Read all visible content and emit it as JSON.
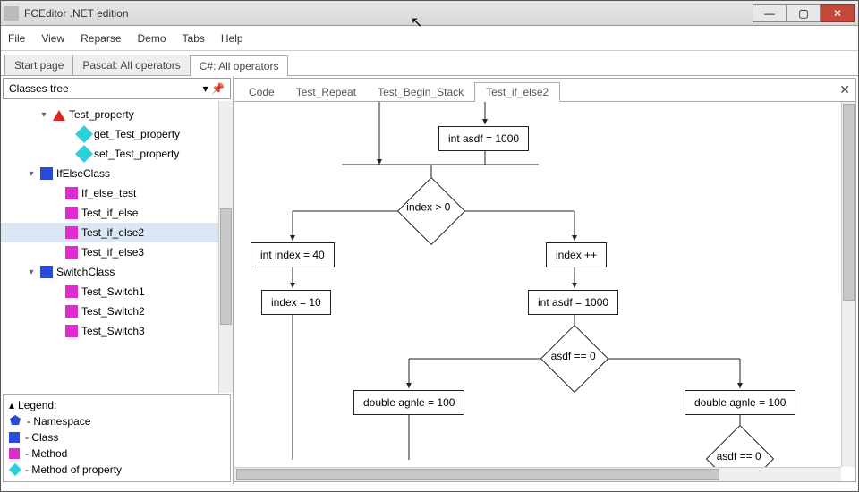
{
  "window": {
    "title": "FCEditor .NET edition",
    "btn_min": "—",
    "btn_max": "▢",
    "btn_close": "✕"
  },
  "menubar": [
    "File",
    "View",
    "Reparse",
    "Demo",
    "Tabs",
    "Help"
  ],
  "doctabs": [
    {
      "label": "Start page",
      "active": false
    },
    {
      "label": "Pascal: All operators",
      "active": false
    },
    {
      "label": "C#: All operators",
      "active": true
    }
  ],
  "sidebar": {
    "header": "Classes tree",
    "tree": [
      {
        "indent": 3,
        "expander": "▾",
        "icon": "red-tri",
        "label": "Test_property"
      },
      {
        "indent": 5,
        "expander": "",
        "icon": "cyan-diamond",
        "label": "get_Test_property"
      },
      {
        "indent": 5,
        "expander": "",
        "icon": "cyan-diamond",
        "label": "set_Test_property"
      },
      {
        "indent": 2,
        "expander": "▾",
        "icon": "blue-sq",
        "label": "IfElseClass"
      },
      {
        "indent": 4,
        "expander": "",
        "icon": "magenta-sq",
        "label": "If_else_test"
      },
      {
        "indent": 4,
        "expander": "",
        "icon": "magenta-sq",
        "label": "Test_if_else"
      },
      {
        "indent": 4,
        "expander": "",
        "icon": "magenta-sq",
        "label": "Test_if_else2",
        "selected": true
      },
      {
        "indent": 4,
        "expander": "",
        "icon": "magenta-sq",
        "label": "Test_if_else3"
      },
      {
        "indent": 2,
        "expander": "▾",
        "icon": "blue-sq",
        "label": "SwitchClass"
      },
      {
        "indent": 4,
        "expander": "",
        "icon": "magenta-sq",
        "label": "Test_Switch1"
      },
      {
        "indent": 4,
        "expander": "",
        "icon": "magenta-sq",
        "label": "Test_Switch2"
      },
      {
        "indent": 4,
        "expander": "",
        "icon": "magenta-sq",
        "label": "Test_Switch3"
      }
    ],
    "legend": {
      "title": "Legend:",
      "items": [
        {
          "icon": "blue-sq",
          "label": "- Namespace",
          "shield": true
        },
        {
          "icon": "blue-sq",
          "label": "- Class"
        },
        {
          "icon": "magenta-sq",
          "label": "- Method"
        },
        {
          "icon": "cyan-diamond",
          "label": "- Method of property"
        }
      ]
    }
  },
  "subtabs": [
    {
      "label": "Code",
      "active": false
    },
    {
      "label": "Test_Repeat",
      "active": false
    },
    {
      "label": "Test_Begin_Stack",
      "active": false
    },
    {
      "label": "Test_if_else2",
      "active": true
    }
  ],
  "flowchart": {
    "nodes": {
      "n1": {
        "text": "int  asdf = 1000"
      },
      "d1": {
        "text": "index > 0"
      },
      "n2": {
        "text": "int  index = 40"
      },
      "n3": {
        "text": "index = 10"
      },
      "n4": {
        "text": "index ++"
      },
      "n5": {
        "text": "int  asdf = 1000"
      },
      "d2": {
        "text": "asdf == 0"
      },
      "n6": {
        "text": "double  agnle = 100"
      },
      "n7": {
        "text": "double  agnle = 100"
      },
      "d3": {
        "text": "asdf == 0"
      }
    }
  }
}
